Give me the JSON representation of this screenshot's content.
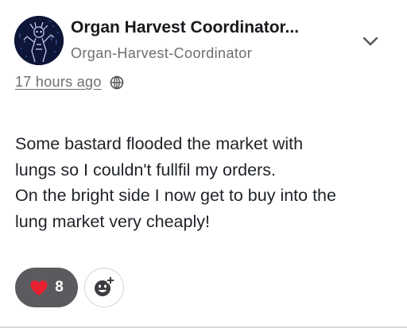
{
  "author": {
    "display_name": "Organ Harvest Coordinator...",
    "username": "Organ-Harvest-Coordinator",
    "avatar_icon": "avatar-image"
  },
  "meta": {
    "timestamp": "17 hours ago",
    "visibility_icon": "globe-icon"
  },
  "post": {
    "lines": [
      "Some bastard flooded the market with",
      "lungs so I couldn't fullfil my orders.",
      "On the bright side I now get to buy into the",
      "lung market very cheaply!"
    ]
  },
  "reactions": {
    "heart_count": "8",
    "heart_icon": "heart-icon",
    "add_reaction_icon": "add-emoji-icon"
  },
  "colors": {
    "heart": "#e8202f",
    "reaction_bg": "#5b5b5f",
    "muted_text": "#6e6e73"
  }
}
